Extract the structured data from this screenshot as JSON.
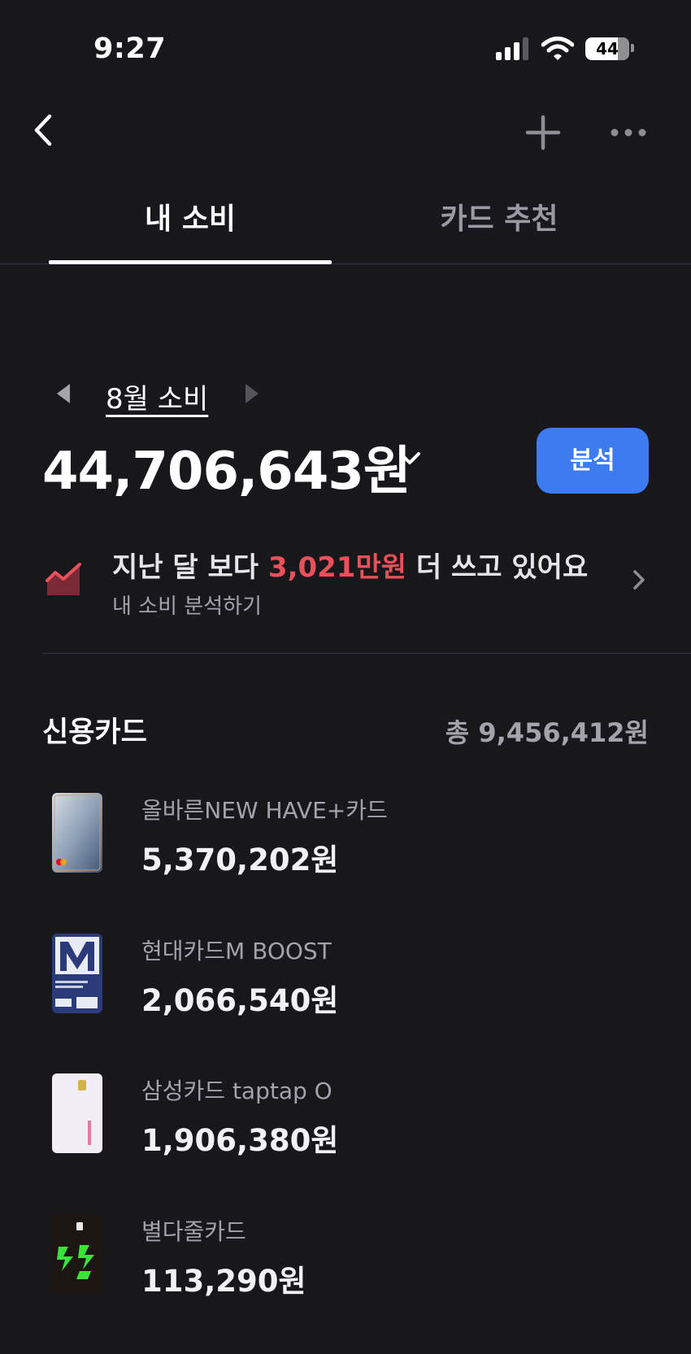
{
  "status_bar": {
    "time": "9:27",
    "battery": "44"
  },
  "tabs": [
    {
      "label": "내 소비",
      "active": true
    },
    {
      "label": "카드 추천",
      "active": false
    }
  ],
  "summary": {
    "month_label": "8월 소비",
    "total": "44,706,643원",
    "analysis_button": "분석"
  },
  "comparison": {
    "prefix": "지난 달 보다 ",
    "highlight": "3,021만원",
    "suffix": " 더 쓰고 있어요",
    "sub": "내 소비 분석하기"
  },
  "credit_cards": {
    "title": "신용카드",
    "total": "총 9,456,412원",
    "items": [
      {
        "name": "올바른NEW HAVE+카드",
        "amount": "5,370,202원"
      },
      {
        "name": "현대카드M BOOST",
        "amount": "2,066,540원"
      },
      {
        "name": "삼성카드 taptap O",
        "amount": "1,906,380원"
      },
      {
        "name": "별다줄카드",
        "amount": "113,290원"
      }
    ]
  },
  "colors": {
    "background": "#17171c",
    "accent": "#3d7bf0",
    "highlight": "#e8505a"
  }
}
